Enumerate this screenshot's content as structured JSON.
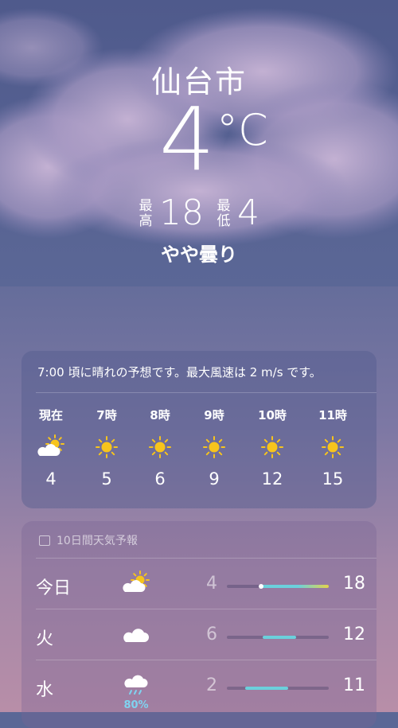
{
  "location": {
    "city": "仙台市"
  },
  "current": {
    "temp": "4",
    "unit": "°C",
    "high_label": "最高",
    "high": "18",
    "low_label": "最低",
    "low": "4",
    "condition": "やや曇り"
  },
  "hourly": {
    "summary": "7:00 頃に晴れの予想です。最大風速は 2 m/s です。",
    "items": [
      {
        "time": "現在",
        "icon": "partly-cloudy-icon",
        "temp": "4"
      },
      {
        "time": "7時",
        "icon": "sun-icon",
        "temp": "5"
      },
      {
        "time": "8時",
        "icon": "sun-icon",
        "temp": "6"
      },
      {
        "time": "9時",
        "icon": "sun-icon",
        "temp": "9"
      },
      {
        "time": "10時",
        "icon": "sun-icon",
        "temp": "12"
      },
      {
        "time": "11時",
        "icon": "sun-icon",
        "temp": "15"
      }
    ]
  },
  "forecast": {
    "title": "10日間天気予報",
    "days": [
      {
        "day": "今日",
        "icon": "partly-cloudy-icon",
        "low": "4",
        "high": "18",
        "bar_start": 0.33,
        "bar_end": 1.0,
        "current_dot": true
      },
      {
        "day": "火",
        "icon": "cloud-icon",
        "low": "6",
        "high": "12",
        "bar_start": 0.35,
        "bar_end": 0.68
      },
      {
        "day": "水",
        "icon": "rain-cloud-icon",
        "low": "2",
        "high": "11",
        "precip": "80%",
        "bar_start": 0.18,
        "bar_end": 0.6
      }
    ]
  },
  "colors": {
    "sun": "#f7c41c",
    "bar_cool": "#6bd0dc",
    "bar_warm": "#e4d34a",
    "precip": "#7fd3f0"
  }
}
